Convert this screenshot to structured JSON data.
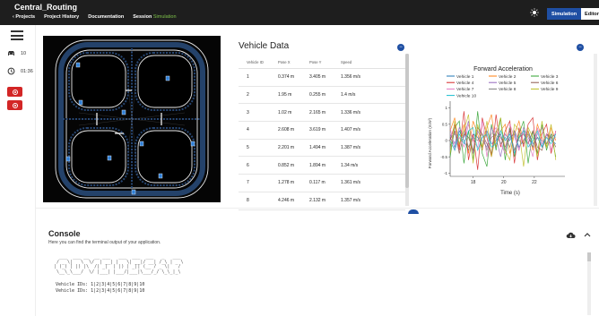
{
  "app": {
    "title": "Central_Routing"
  },
  "nav": {
    "back_label": "Projects",
    "project_history": "Project History",
    "documentation": "Documentation",
    "session_label": "Session",
    "session_value": "Simulation"
  },
  "modes": {
    "simulation": "Simulation",
    "editor": "Editor"
  },
  "sidebar": {
    "vehicle_count": "10",
    "time": "01:36"
  },
  "vehicle_data": {
    "title": "Vehicle Data",
    "columns": [
      "Vehicle ID",
      "Pose X",
      "Pose Y",
      "Speed"
    ],
    "rows": [
      [
        "1",
        "0.374 m",
        "3.405 m",
        "1.356 m/s"
      ],
      [
        "2",
        "1.95 m",
        "0.255 m",
        "1.4 m/s"
      ],
      [
        "3",
        "1.02 m",
        "2.165 m",
        "1.336 m/s"
      ],
      [
        "4",
        "2.608 m",
        "3.619 m",
        "1.407 m/s"
      ],
      [
        "5",
        "2.201 m",
        "1.494 m",
        "1.387 m/s"
      ],
      [
        "6",
        "0.852 m",
        "1.894 m",
        "1.34 m/s"
      ],
      [
        "7",
        "1.278 m",
        "0.117 m",
        "1.361 m/s"
      ],
      [
        "8",
        "4.246 m",
        "2.132 m",
        "1.357 m/s"
      ]
    ]
  },
  "colors": {
    "accent": "#1f4fa3",
    "record": "#d32626",
    "topbar": "#1e1e1e",
    "session_green": "#7ec24a"
  },
  "console": {
    "title": "Console",
    "subtitle": "Here you can find the terminal output of your application.",
    "ascii_art": "  ___  ___ __  __ ___   ___  ___  ___   _   ___\n / _ \\|   \\  \\/  | __| |   \\| __|/ __| /_\\ | _ \\\n| (_) | |) |\\  /| _|  | |) | _|| (__ / _ \\|   /\n \\__\\_\\___/  \\/ |___| |___/|___|\\___/_/ \\_\\_|_\\",
    "lines": [
      "Vehicle IDs: 1|2|3|4|5|6|7|8|9|10",
      "Vehicle IDs: 1|2|3|4|5|6|7|8|9|10"
    ]
  },
  "chart_data": {
    "type": "line",
    "title": "Forward Acceleration",
    "xlabel": "Time (s)",
    "ylabel": "Forward Acceleration (m/s²)",
    "xlim": [
      16.5,
      24
    ],
    "ylim": [
      -1.1,
      1.1
    ],
    "xticks": [
      18,
      20,
      22
    ],
    "yticks": [
      -1,
      -0.5,
      0,
      0.5,
      1
    ],
    "legend": "top",
    "x": [
      16.5,
      16.8,
      17.1,
      17.4,
      17.7,
      18.0,
      18.3,
      18.6,
      18.9,
      19.2,
      19.5,
      19.8,
      20.1,
      20.4,
      20.7,
      21.0,
      21.3,
      21.6,
      21.9,
      22.2,
      22.5,
      22.8,
      23.1,
      23.4
    ],
    "series": [
      {
        "name": "Vehicle 1",
        "color": "#1f77b4",
        "values": [
          0.1,
          -0.2,
          0.3,
          0.0,
          -0.3,
          0.2,
          0.1,
          -0.2,
          0.3,
          -0.1,
          0.0,
          0.2,
          -0.3,
          0.1,
          0.2,
          -0.2,
          0.0,
          0.3,
          -0.1,
          0.1,
          -0.2,
          0.2,
          0.0,
          -0.1
        ]
      },
      {
        "name": "Vehicle 2",
        "color": "#ff7f0e",
        "values": [
          0.3,
          0.7,
          -0.2,
          0.5,
          -0.4,
          0.6,
          0.2,
          -0.3,
          0.4,
          0.8,
          -0.2,
          0.3,
          0.5,
          -0.4,
          0.2,
          0.6,
          -0.1,
          0.3,
          -0.3,
          0.5,
          0.1,
          -0.2,
          0.4,
          0.0
        ]
      },
      {
        "name": "Vehicle 3",
        "color": "#2ca02c",
        "values": [
          -0.5,
          0.4,
          0.6,
          -0.7,
          0.3,
          -0.6,
          0.9,
          -0.4,
          -0.8,
          0.5,
          -0.3,
          0.7,
          -0.6,
          0.4,
          -0.5,
          0.2,
          0.6,
          -0.7,
          0.3,
          -0.4,
          0.5,
          -0.3,
          0.2,
          -0.5
        ]
      },
      {
        "name": "Vehicle 4",
        "color": "#d62728",
        "values": [
          0.0,
          0.5,
          -0.3,
          0.9,
          -0.6,
          0.2,
          -0.9,
          0.7,
          0.1,
          -0.5,
          0.8,
          -0.2,
          0.3,
          0.6,
          -0.7,
          0.4,
          -0.2,
          0.5,
          0.7,
          -0.6,
          0.2,
          0.5,
          -0.4,
          0.3
        ]
      },
      {
        "name": "Vehicle 5",
        "color": "#9467bd",
        "values": [
          0.2,
          -0.1,
          0.4,
          0.1,
          0.6,
          -0.4,
          0.3,
          0.0,
          -0.2,
          0.4,
          0.1,
          -0.5,
          0.2,
          0.0,
          0.3,
          -0.3,
          0.4,
          0.1,
          -0.2,
          0.2,
          0.4,
          -0.1,
          0.1,
          0.2
        ]
      },
      {
        "name": "Vehicle 6",
        "color": "#8c564b",
        "values": [
          -0.2,
          0.3,
          -0.4,
          0.2,
          0.1,
          -0.3,
          0.4,
          0.2,
          -0.1,
          -0.4,
          0.3,
          0.1,
          -0.2,
          0.3,
          -0.3,
          0.1,
          0.2,
          -0.1,
          0.3,
          -0.2,
          -0.3,
          0.2,
          0.1,
          -0.2
        ]
      },
      {
        "name": "Vehicle 7",
        "color": "#e377c2",
        "values": [
          0.4,
          -0.3,
          0.1,
          -0.2,
          0.5,
          0.0,
          -0.2,
          0.6,
          -0.5,
          0.2,
          0.4,
          -0.1,
          -0.4,
          0.5,
          0.1,
          -0.3,
          0.3,
          0.0,
          -0.5,
          0.4,
          -0.1,
          0.2,
          -0.3,
          0.3
        ]
      },
      {
        "name": "Vehicle 8",
        "color": "#7f7f7f",
        "values": [
          0.1,
          0.2,
          -0.1,
          0.3,
          -0.2,
          0.1,
          0.0,
          0.2,
          -0.3,
          0.1,
          0.2,
          -0.1,
          0.1,
          -0.2,
          0.3,
          0.0,
          -0.1,
          0.2,
          -0.2,
          0.1,
          0.0,
          -0.1,
          0.2,
          0.1
        ]
      },
      {
        "name": "Vehicle 9",
        "color": "#bcbd22",
        "values": [
          -0.4,
          0.6,
          -0.1,
          0.3,
          0.8,
          -0.7,
          0.5,
          -0.2,
          0.6,
          -0.5,
          0.2,
          0.7,
          -0.3,
          -0.6,
          0.5,
          0.3,
          -0.8,
          0.4,
          0.1,
          -0.5,
          0.6,
          -0.2,
          0.5,
          -0.6
        ]
      },
      {
        "name": "Vehicle 10",
        "color": "#17becf",
        "values": [
          0.0,
          -0.3,
          0.2,
          -0.1,
          0.3,
          0.4,
          -0.3,
          0.1,
          0.2,
          -0.2,
          -0.1,
          0.3,
          0.0,
          0.2,
          -0.4,
          0.1,
          0.3,
          -0.2,
          0.0,
          0.3,
          -0.2,
          0.1,
          -0.1,
          0.2
        ]
      }
    ]
  }
}
